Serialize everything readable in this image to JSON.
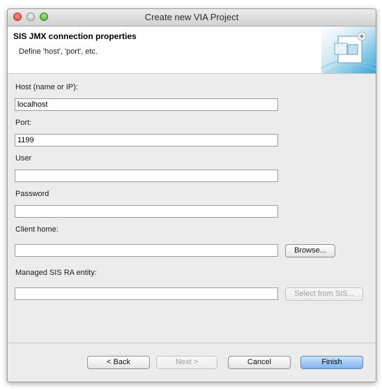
{
  "window": {
    "title": "Create new VIA Project"
  },
  "banner": {
    "title": "SIS JMX connection properties",
    "description": "Define 'host', 'port', etc."
  },
  "form": {
    "host": {
      "label": "Host (name or IP):",
      "value": "localhost"
    },
    "port": {
      "label": "Port:",
      "value": "1199"
    },
    "user": {
      "label": "User",
      "value": ""
    },
    "password": {
      "label": "Password",
      "value": ""
    },
    "client_home": {
      "label": "Client home:",
      "value": "",
      "button": "Browse..."
    },
    "managed_entity": {
      "label": "Managed SIS RA entity:",
      "value": "",
      "button": "Select from SIS..."
    }
  },
  "footer": {
    "back": "< Back",
    "next": "Next >",
    "cancel": "Cancel",
    "finish": "Finish"
  }
}
